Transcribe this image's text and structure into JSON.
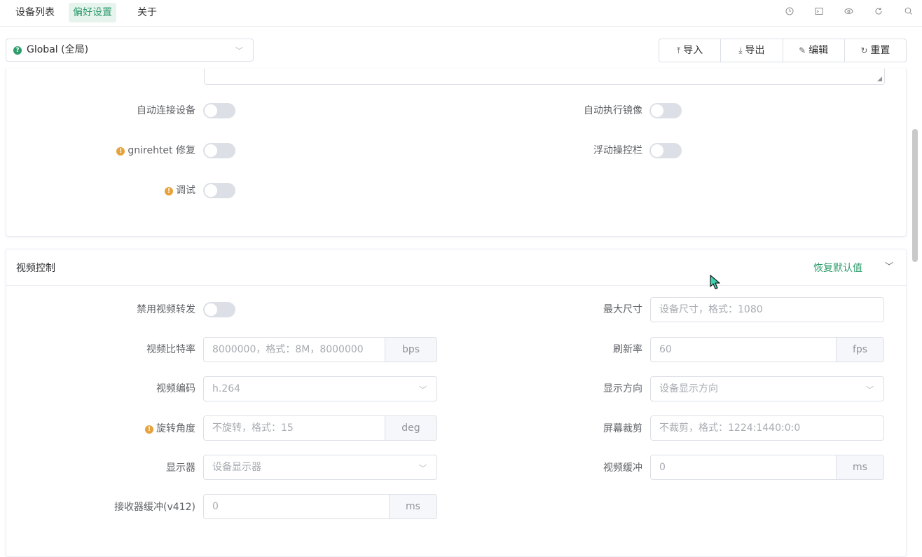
{
  "nav": {
    "tabs": [
      {
        "label": "设备列表"
      },
      {
        "label": "偏好设置"
      },
      {
        "label": "关于"
      }
    ],
    "icons": [
      "clock-icon",
      "terminal-icon",
      "eye-icon",
      "refresh-icon",
      "search-icon"
    ]
  },
  "scope_select": {
    "value": "Global (全局)"
  },
  "actions": {
    "import": "导入",
    "export": "导出",
    "edit": "编辑",
    "reset": "重置"
  },
  "general": {
    "auto_connect": "自动连接设备",
    "auto_mirror": "自动执行镜像",
    "gnirehtet_fix": "gnirehtet 修复",
    "floating_bar": "浮动操控栏",
    "debug": "调试"
  },
  "video": {
    "title": "视频控制",
    "restore_defaults": "恢复默认值",
    "disable_video_forward": "禁用视频转发",
    "max_size": {
      "label": "最大尺寸",
      "placeholder": "设备尺寸，格式：1080"
    },
    "bitrate": {
      "label": "视频比特率",
      "placeholder": "8000000，格式：8M，8000000",
      "unit": "bps"
    },
    "fps": {
      "label": "刷新率",
      "placeholder": "60",
      "unit": "fps"
    },
    "codec": {
      "label": "视频编码",
      "placeholder": "h.264"
    },
    "orientation": {
      "label": "显示方向",
      "placeholder": "设备显示方向"
    },
    "rotation": {
      "label": "旋转角度",
      "placeholder": "不旋转，格式：15",
      "unit": "deg"
    },
    "crop": {
      "label": "屏幕裁剪",
      "placeholder": "不裁剪，格式：1224:1440:0:0"
    },
    "display": {
      "label": "显示器",
      "placeholder": "设备显示器"
    },
    "video_buffer": {
      "label": "视频缓冲",
      "placeholder": "0",
      "unit": "ms"
    },
    "receiver_buffer": {
      "label": "接收器缓冲(v412)",
      "placeholder": "0",
      "unit": "ms"
    }
  },
  "colors": {
    "accent": "#2f9c6c",
    "warning": "#e6a23c"
  }
}
